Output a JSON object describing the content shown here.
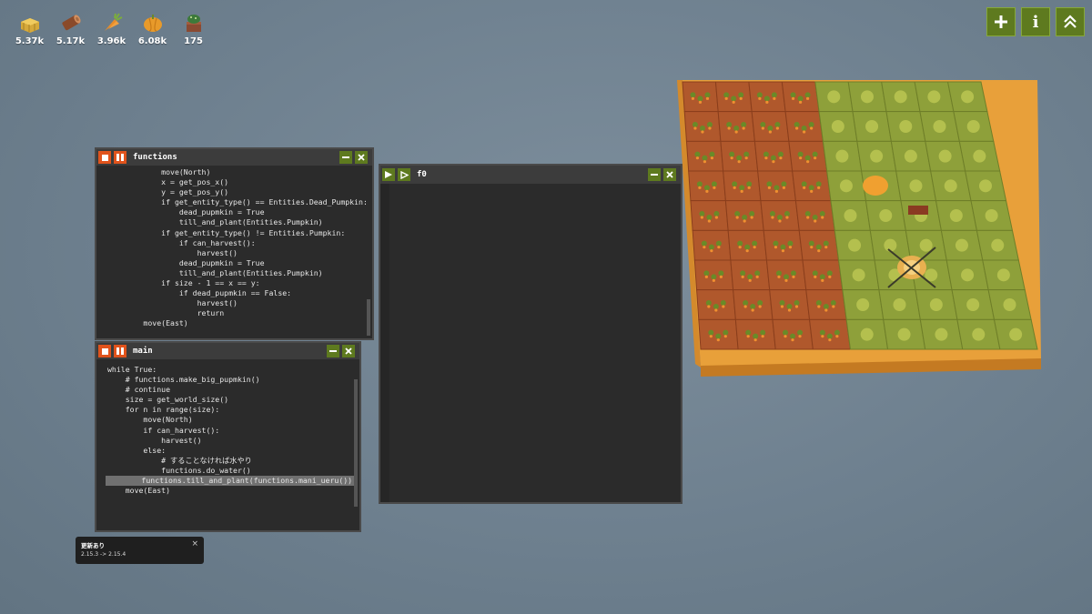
{
  "resources": [
    {
      "icon": "hay-icon",
      "value": "5.37k"
    },
    {
      "icon": "wood-icon",
      "value": "5.17k"
    },
    {
      "icon": "carrot-icon",
      "value": "3.96k"
    },
    {
      "icon": "pumpkin-icon",
      "value": "6.08k"
    },
    {
      "icon": "cactus-icon",
      "value": "175"
    }
  ],
  "top_buttons": [
    {
      "icon": "plus-icon",
      "label": "+"
    },
    {
      "icon": "info-icon",
      "label": "i"
    },
    {
      "icon": "double-chevron-up-icon",
      "label": ""
    }
  ],
  "windows": {
    "functions": {
      "title": "functions",
      "lines": [
        "            move(North)",
        "            x = get_pos_x()",
        "            y = get_pos_y()",
        "            if get_entity_type() == Entities.Dead_Pumpkin:",
        "                dead_pupmkin = True",
        "                till_and_plant(Entities.Pumpkin)",
        "            if get_entity_type() != Entities.Pumpkin:",
        "                if can_harvest():",
        "                    harvest()",
        "                dead_pupmkin = True",
        "                till_and_plant(Entities.Pumpkin)",
        "",
        "            if size - 1 == x == y:",
        "                if dead_pupmkin == False:",
        "                    harvest()",
        "                    return",
        "        move(East)"
      ]
    },
    "main": {
      "title": "main",
      "lines": [
        "while True:",
        "    # functions.make_big_pupmkin()",
        "    # continue",
        "    size = get_world_size()",
        "    for n in range(size):",
        "",
        "        move(North)",
        "        if can_harvest():",
        "            harvest()",
        "        else:",
        "            # することなければ水やり",
        "            functions.do_water()",
        "        functions.till_and_plant(functions.mani_ueru())",
        "    move(East)"
      ],
      "highlight_line": 12
    },
    "f0": {
      "title": "f0",
      "lines": []
    }
  },
  "toast": {
    "title": "更新あり",
    "detail": "2.15.3 -> 2.15.4",
    "close": "×"
  },
  "colors": {
    "accent_green": "#5e7a1f",
    "stop_orange": "#e0531c",
    "editor_bg": "#2b2b2b"
  }
}
